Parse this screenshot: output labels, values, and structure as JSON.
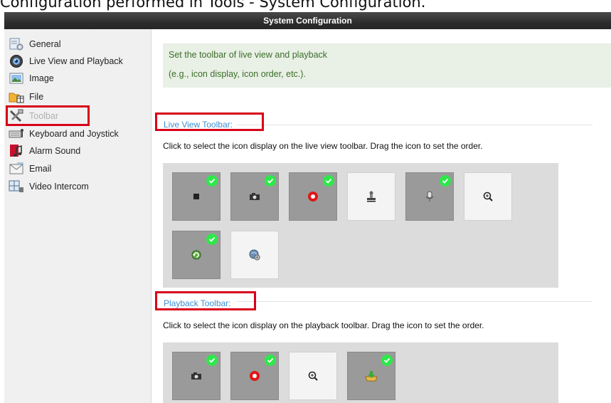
{
  "caption": "Configuration performed in Tools - System Configuration.",
  "window": {
    "title": "System Configuration"
  },
  "sidebar": {
    "items": [
      {
        "label": "General",
        "icon": "general-icon"
      },
      {
        "label": "Live View and Playback",
        "icon": "webcam-icon"
      },
      {
        "label": "Image",
        "icon": "image-icon"
      },
      {
        "label": "File",
        "icon": "folder-icon"
      },
      {
        "label": "Toolbar",
        "icon": "tools-icon",
        "state": "selected"
      },
      {
        "label": "Keyboard and Joystick",
        "icon": "keyboard-icon"
      },
      {
        "label": "Alarm Sound",
        "icon": "music-icon"
      },
      {
        "label": "Email",
        "icon": "email-icon"
      },
      {
        "label": "Video Intercom",
        "icon": "intercom-icon"
      }
    ]
  },
  "main": {
    "banner": {
      "line1": "Set the toolbar of live view and playback",
      "line2": "(e.g., icon display, icon order, etc.)."
    },
    "live_view": {
      "title": "Live View Toolbar:",
      "description": "Click to select the icon display on the live view toolbar. Drag the icon to set the order.",
      "tiles": [
        {
          "icon": "stop-icon",
          "selected": true
        },
        {
          "icon": "camera-capture-icon",
          "selected": true
        },
        {
          "icon": "record-icon",
          "selected": true
        },
        {
          "icon": "stamp-icon",
          "selected": false
        },
        {
          "icon": "microphone-icon",
          "selected": true
        },
        {
          "icon": "zoom-icon",
          "selected": false
        },
        {
          "icon": "ptz-return-icon",
          "selected": true
        },
        {
          "icon": "globe-settings-icon",
          "selected": false
        }
      ]
    },
    "playback": {
      "title": "Playback Toolbar:",
      "description": "Click to select the icon display on the playback toolbar. Drag the icon to set the order.",
      "tiles": [
        {
          "icon": "camera-capture-icon",
          "selected": true
        },
        {
          "icon": "record-icon",
          "selected": true
        },
        {
          "icon": "zoom-icon",
          "selected": false
        },
        {
          "icon": "download-icon",
          "selected": true
        }
      ]
    }
  },
  "colors": {
    "highlight": "#d8001a",
    "check": "#2ee84a",
    "link": "#3b8fd4",
    "banner_text": "#3b6e2c",
    "tile_selected": "#9a9a9a"
  }
}
